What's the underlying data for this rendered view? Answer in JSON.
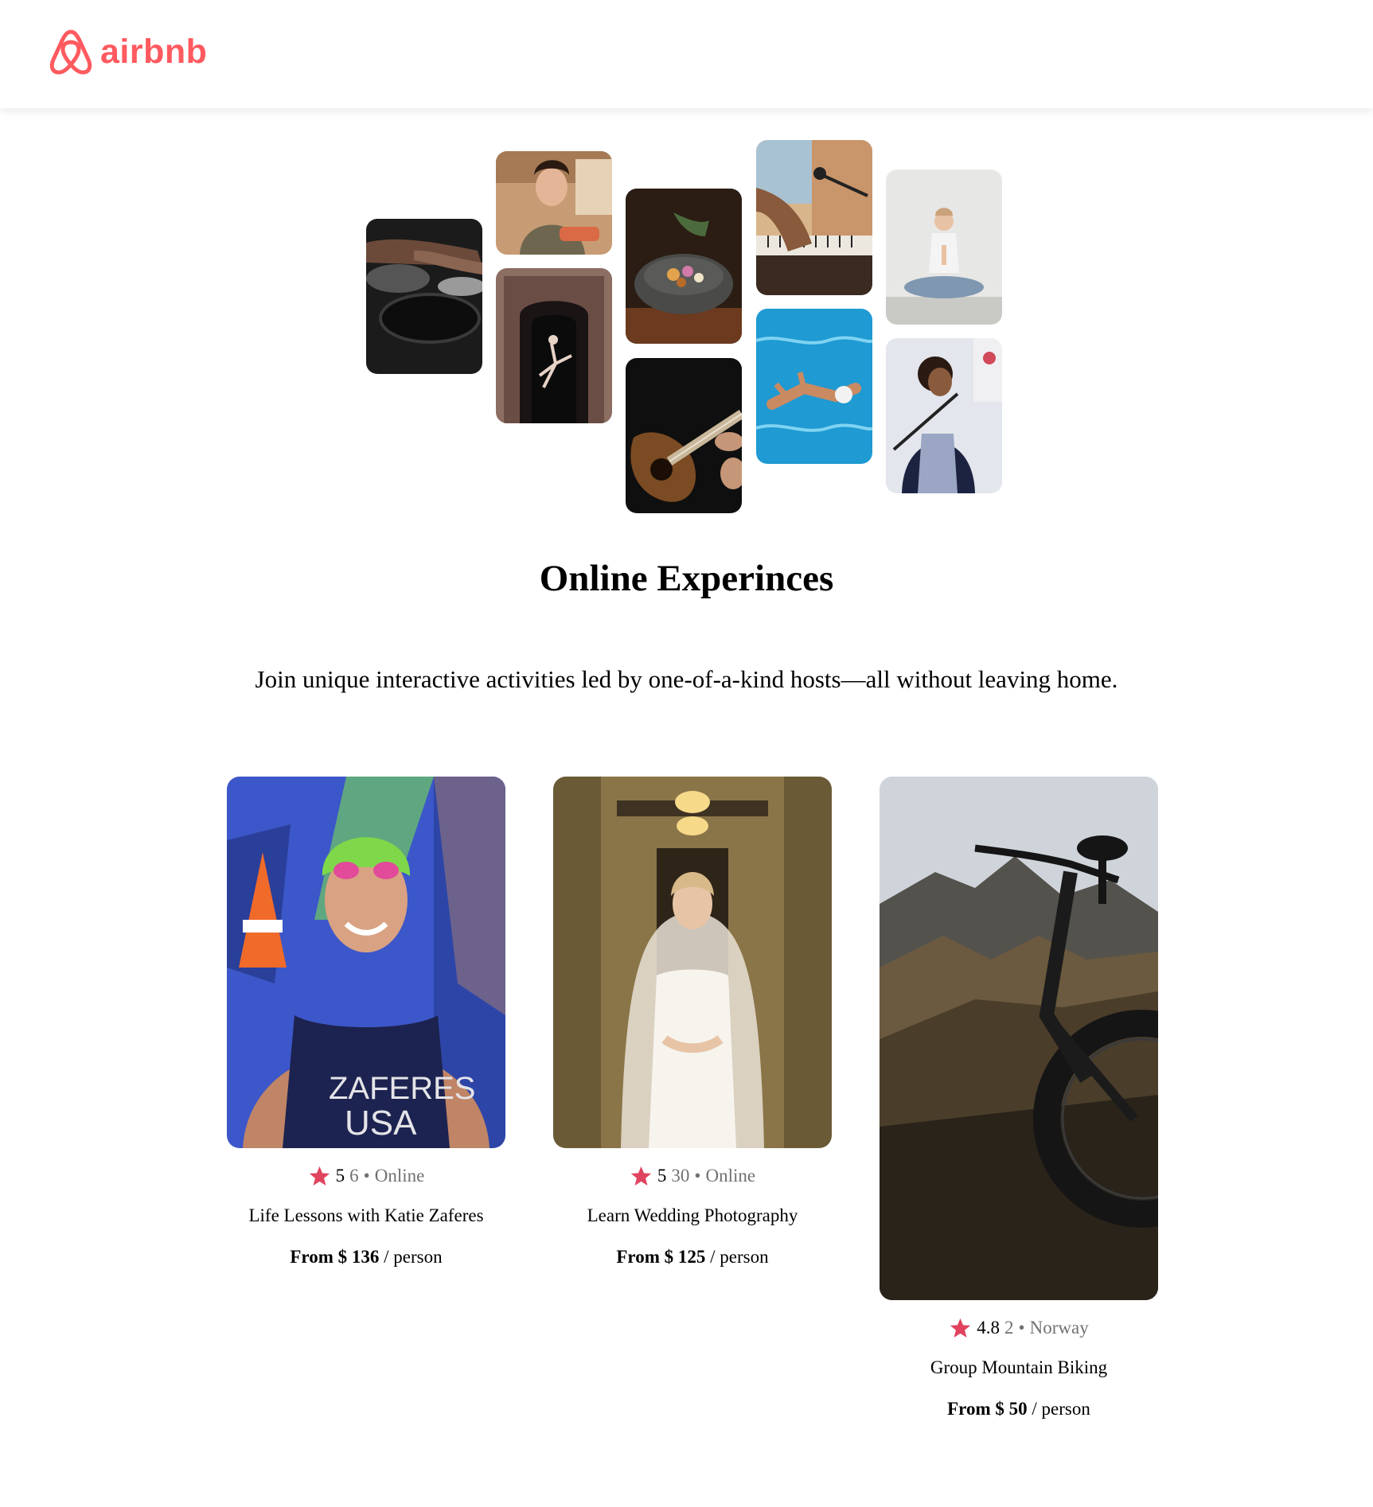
{
  "brand": {
    "name": "airbnb",
    "logo_icon": "airbnb-belo-logo-icon",
    "color": "#FF5A5F"
  },
  "gallery": {
    "tiles": [
      {
        "icon": "cooking-pans-photo"
      },
      {
        "icon": "chef-woman-photo"
      },
      {
        "icon": "dancer-doorway-photo"
      },
      {
        "icon": "stone-bowl-dish-photo"
      },
      {
        "icon": "acoustic-guitar-photo"
      },
      {
        "icon": "piano-microphone-photo"
      },
      {
        "icon": "swimmer-pool-photo"
      },
      {
        "icon": "meditation-yoga-photo"
      },
      {
        "icon": "singer-microphone-photo"
      }
    ]
  },
  "hero": {
    "title": "Online Experinces",
    "subtitle": "Join unique interactive activities led by one-of-a-kind hosts—all without leaving home."
  },
  "cards": [
    {
      "photo": "triathlete-zaferes-photo",
      "rating": "5",
      "review_count": "6",
      "separator": "•",
      "location": "Online",
      "title": "Life Lessons with Katie Zaferes",
      "price_label": "From $ 136",
      "price_unit": "/ person"
    },
    {
      "photo": "bride-wedding-photo",
      "rating": "5",
      "review_count": "30",
      "separator": "•",
      "location": "Online",
      "title": "Learn Wedding Photography",
      "price_label": "From $ 125",
      "price_unit": "/ person"
    },
    {
      "photo": "mountain-bike-photo",
      "rating": "4.8",
      "review_count": "2",
      "separator": "•",
      "location": "Norway",
      "title": "Group Mountain Biking",
      "price_label": "From $ 50",
      "price_unit": "/ person"
    }
  ],
  "colors": {
    "star": "#E0435E",
    "muted_text": "#717171",
    "brand": "#FF5A5F"
  }
}
